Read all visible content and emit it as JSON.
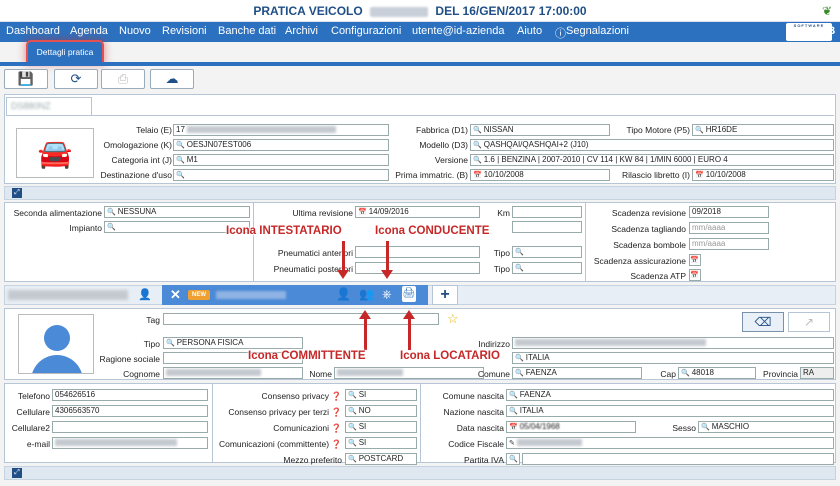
{
  "window": {
    "title_pre": "PRATICA VEICOLO",
    "title_post": "DEL 16/GEN/2017 17:00:00"
  },
  "nav": {
    "items": [
      "Dashboard",
      "Agenda",
      "Nuovo",
      "Revisioni",
      "Banche dati",
      "Archivi",
      "Configurazioni",
      "utente@id-azienda",
      "Aiuto",
      "Segnalazioni"
    ],
    "logo": "MMB",
    "logo_sub": "SOFTWARE"
  },
  "subtab": {
    "label": "Dettagli pratica"
  },
  "vehicle": {
    "tab_label": "DS880NZ",
    "labels": {
      "telaio": "Telaio (E)",
      "omologazione": "Omologazione (K)",
      "categoria": "Categoria int (J)",
      "destinazione": "Destinazione d'uso",
      "fabbrica": "Fabbrica (D1)",
      "modello": "Modello (D3)",
      "versione": "Versione",
      "prima_immatric": "Prima immatric. (B)",
      "tipo_motore": "Tipo Motore (P5)",
      "rilascio": "Rilascio libretto (I)"
    },
    "values": {
      "telaio_prefix": "17",
      "omologazione": "OESJN07EST006",
      "categoria": "M1",
      "destinazione": "",
      "fabbrica": "NISSAN",
      "modello": "QASHQAI/QASHQAI+2 (J10)",
      "versione": "1.6 | BENZINA | 2007-2010 | CV 114 | KW 84 | 1/MIN 6000 | EURO 4",
      "prima_immatric": "10/10/2008",
      "tipo_motore": "HR16DE",
      "rilascio": "10/10/2008"
    }
  },
  "details": {
    "labels": {
      "seconda_alimentazione": "Seconda alimentazione",
      "impianto": "Impianto",
      "ultima_revisione": "Ultima revisione",
      "km": "Km",
      "pneu_ant": "Pneumatici anteriori",
      "pneu_post": "Pneumatici posteriori",
      "tipo": "Tipo",
      "scad_revisione": "Scadenza revisione",
      "scad_tagliando": "Scadenza tagliando",
      "scad_bombole": "Scadenza bombole",
      "scad_assicurazione": "Scadenza assicurazione",
      "scad_atp": "Scadenza ATP"
    },
    "values": {
      "seconda_alimentazione": "NESSUNA",
      "ultima_revisione": "14/09/2016",
      "scad_revisione": "09/2018"
    },
    "placeholders": {
      "scad_tagliando": "mm/aaaa",
      "scad_bombole": "mm/aaaa"
    }
  },
  "annotations": {
    "intestatario_pre": "Icona",
    "intestatario": "INTESTATARIO",
    "conducente_pre": "Icona",
    "conducente": "CONDUCENTE",
    "committente_pre": "Icona",
    "committente": "COMMITTENTE",
    "locatario_pre": "Icona",
    "locatario": "LOCATARIO"
  },
  "person_tabs": {
    "new_badge": "NEW",
    "plus": "+"
  },
  "person": {
    "labels": {
      "tag": "Tag",
      "tipo": "Tipo",
      "ragione_sociale": "Ragione sociale",
      "cognome": "Cognome",
      "nome": "Nome",
      "indirizzo": "Indirizzo",
      "comune": "Comune",
      "cap": "Cap",
      "provincia": "Provincia"
    },
    "values": {
      "tipo": "PERSONA FISICA",
      "indirizzo_country": "ITALIA",
      "comune": "FAENZA",
      "cap": "48018",
      "provincia": "RA"
    }
  },
  "contacts": {
    "labels": {
      "telefono": "Telefono",
      "cellulare": "Cellulare",
      "cellulare2": "Cellulare2",
      "email": "e-mail",
      "consenso_privacy": "Consenso privacy",
      "consenso_terzi": "Consenso privacy per terzi",
      "comunicazioni": "Comunicazioni",
      "comunicazioni_comm": "Comunicazioni (committente)",
      "mezzo": "Mezzo preferito",
      "comune_nascita": "Comune nascita",
      "nazione_nascita": "Nazione nascita",
      "data_nascita": "Data nascita",
      "sesso": "Sesso",
      "codice_fiscale": "Codice Fiscale",
      "partita_iva": "Partita IVA"
    },
    "values": {
      "telefono": "054626516",
      "cellulare": "4306563570",
      "consenso_privacy": "SI",
      "consenso_terzi": "NO",
      "comunicazioni": "SI",
      "comunicazioni_comm": "SI",
      "mezzo": "POSTCARD",
      "comune_nascita": "FAENZA",
      "nazione_nascita": "ITALIA",
      "data_nascita": "05/04/1968",
      "sesso": "MASCHIO"
    }
  }
}
